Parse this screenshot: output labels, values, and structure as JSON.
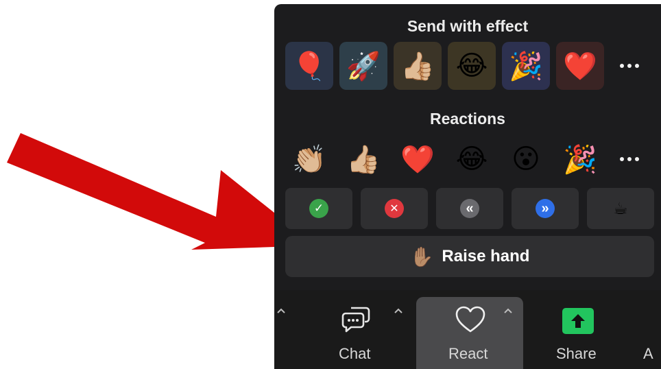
{
  "effects": {
    "title": "Send with effect",
    "items": [
      {
        "name": "balloon",
        "glyph": "🎈",
        "bg": "#2b3447"
      },
      {
        "name": "rocket",
        "glyph": "🚀",
        "bg": "#2e3f4a"
      },
      {
        "name": "thumbs-up",
        "glyph": "👍🏼",
        "bg": "#3b3427"
      },
      {
        "name": "laughing",
        "glyph": "😂",
        "bg": "#3d3624"
      },
      {
        "name": "party-popper",
        "glyph": "🎉",
        "bg": "#2d3150"
      },
      {
        "name": "heart",
        "glyph": "❤️",
        "bg": "#3a2424"
      }
    ]
  },
  "reactions": {
    "title": "Reactions",
    "items": [
      {
        "name": "clapping",
        "glyph": "👏🏼"
      },
      {
        "name": "thumbs-up",
        "glyph": "👍🏼"
      },
      {
        "name": "heart",
        "glyph": "❤️"
      },
      {
        "name": "laughing",
        "glyph": "😂"
      },
      {
        "name": "surprised",
        "glyph": "😮"
      },
      {
        "name": "party-popper",
        "glyph": "🎉"
      }
    ]
  },
  "status": {
    "items": [
      {
        "name": "yes",
        "glyph": "✓",
        "color": "#3aa34a"
      },
      {
        "name": "no",
        "glyph": "✕",
        "color": "#e0383e"
      },
      {
        "name": "slower",
        "glyph": "«",
        "color": "#6a6a6e"
      },
      {
        "name": "faster",
        "glyph": "»",
        "color": "#2f6fe8"
      },
      {
        "name": "coffee",
        "glyph": "☕",
        "color": "#2f2f31"
      }
    ]
  },
  "raise_hand": {
    "label": "Raise hand",
    "glyph": "✋🏽"
  },
  "toolbar": {
    "chat_label": "Chat",
    "react_label": "React",
    "share_label": "Share",
    "partial_label": "A",
    "share_color": "#22c55e"
  },
  "annotation": {
    "arrow_color": "#d20a0a"
  }
}
